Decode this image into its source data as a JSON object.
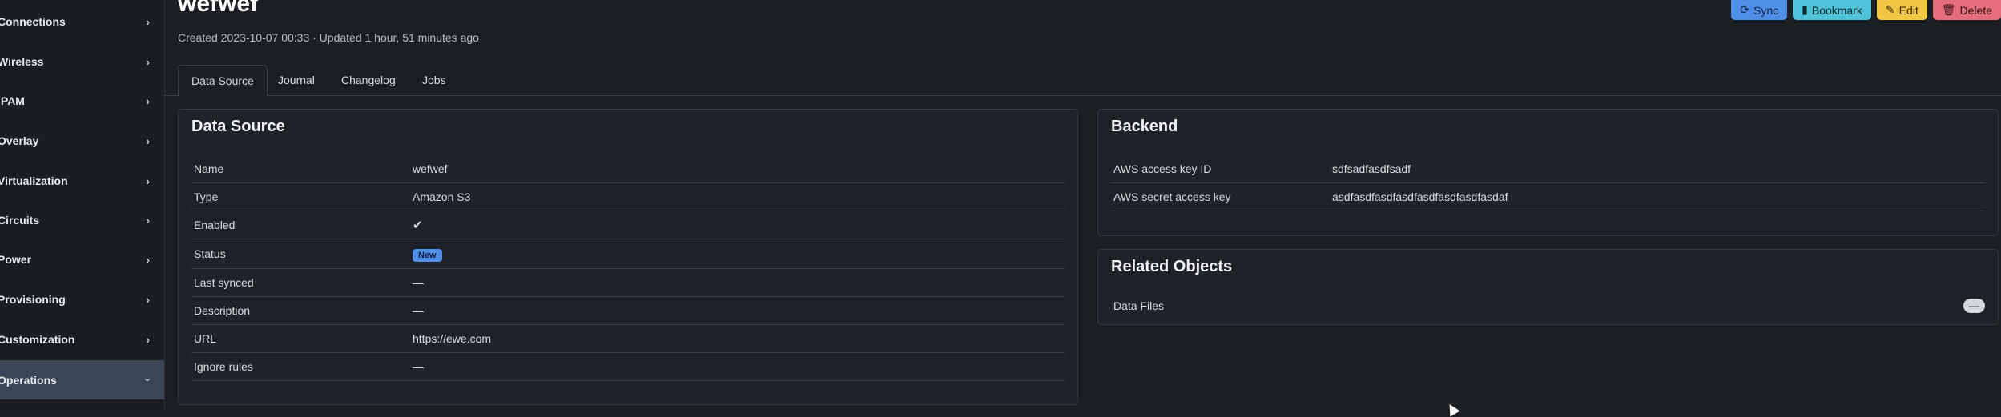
{
  "sidebar": {
    "items": [
      {
        "label": "Connections"
      },
      {
        "label": "Wireless"
      },
      {
        "label": "IPAM"
      },
      {
        "label": "Overlay"
      },
      {
        "label": "Virtualization"
      },
      {
        "label": "Circuits"
      },
      {
        "label": "Power"
      },
      {
        "label": "Provisioning"
      },
      {
        "label": "Customization"
      },
      {
        "label": "Operations"
      }
    ],
    "chevron": "›"
  },
  "header": {
    "title": "wefwef",
    "meta": "Created 2023-10-07 00:33 · Updated 1 hour, 51 minutes ago"
  },
  "buttons": {
    "sync": "Sync",
    "bookmark": "Bookmark",
    "edit": "Edit",
    "delete": "Delete"
  },
  "tabs": [
    "Data Source",
    "Journal",
    "Changelog",
    "Jobs"
  ],
  "data_source": {
    "title": "Data Source",
    "rows": [
      {
        "key": "Name",
        "value": "wefwef"
      },
      {
        "key": "Type",
        "value": "Amazon S3"
      },
      {
        "key": "Enabled",
        "value": "✔"
      },
      {
        "key": "Status",
        "value": "New"
      },
      {
        "key": "Last synced",
        "value": "—"
      },
      {
        "key": "Description",
        "value": "—"
      },
      {
        "key": "URL",
        "value": "https://ewe.com"
      },
      {
        "key": "Ignore rules",
        "value": "—"
      }
    ]
  },
  "backend": {
    "title": "Backend",
    "rows": [
      {
        "key": "AWS access key ID",
        "value": "sdfsadfasdfsadf"
      },
      {
        "key": "AWS secret access key",
        "value": "asdfasdfasdfasdfasdfasdfasdfasdaf"
      }
    ]
  },
  "related": {
    "title": "Related Objects",
    "rows": [
      {
        "key": "Data Files",
        "count": "—"
      }
    ]
  },
  "colors": {
    "accent": "#4f8fe8",
    "status_new": "#4f8fe8",
    "enabled_check": "#3fb37f",
    "link": "#6ea8fe"
  }
}
